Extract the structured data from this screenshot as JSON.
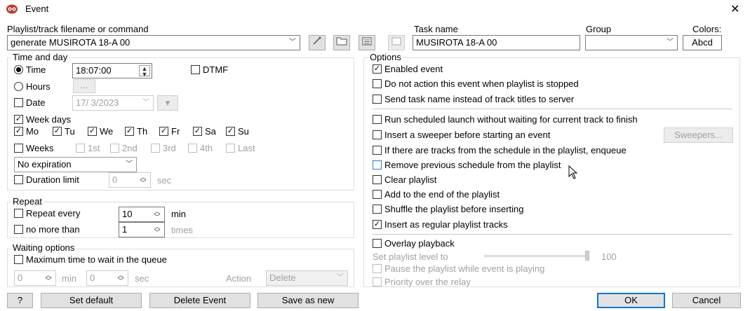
{
  "window": {
    "title": "Event",
    "close": "✕"
  },
  "top": {
    "playlist_label": "Playlist/track filename or command",
    "playlist_value": "generate MUSIROTA 18-A 00",
    "task_label": "Task name",
    "task_value": "MUSIROTA 18-A 00",
    "group_label": "Group",
    "group_value": "",
    "colors_label": "Colors:",
    "colors_value": "Abcd"
  },
  "time_day": {
    "title": "Time and day",
    "time_label": "Time",
    "time_value": "18:07:00",
    "dtmf_label": "DTMF",
    "hours_label": "Hours",
    "hours_btn": "...",
    "date_label": "Date",
    "date_value": "17/ 3/2023",
    "week_days_label": "Week days",
    "days": [
      "Mo",
      "Tu",
      "We",
      "Th",
      "Fr",
      "Sa",
      "Su"
    ],
    "weeks_label": "Weeks",
    "weeks": [
      "1st",
      "2nd",
      "3rd",
      "4th",
      "Last"
    ],
    "expiration_value": "No expiration",
    "duration_label": "Duration limit",
    "duration_value": "0",
    "duration_unit": "sec"
  },
  "repeat": {
    "title": "Repeat",
    "every_label": "Repeat every",
    "every_value": "10",
    "every_unit": "min",
    "nomore_label": "no more than",
    "nomore_value": "1",
    "nomore_unit": "times"
  },
  "waiting": {
    "title": "Waiting options",
    "max_label": "Maximum time to wait in the queue",
    "min_value": "0",
    "min_unit": "min",
    "sec_value": "0",
    "sec_unit": "sec",
    "action_label": "Action",
    "action_value": "Delete"
  },
  "options": {
    "title": "Options",
    "enabled": "Enabled event",
    "no_action": "Do not action this event when playlist is stopped",
    "send_task": "Send task name instead of track titles to server",
    "run_sched": "Run scheduled launch without waiting for current track to finish",
    "sweeper": "Insert a sweeper before starting an event",
    "sweepers_btn": "Sweepers...",
    "enqueue": "If there are tracks from the schedule in the playlist, enqueue",
    "remove_prev": "Remove previous schedule from the playlist",
    "clear": "Clear playlist",
    "add_end": "Add to the end of the playlist",
    "shuffle": "Shuffle the playlist before inserting",
    "regular": "Insert as regular playlist tracks",
    "overlay": "Overlay playback",
    "level_label": "Set playlist level to",
    "level_value": "100",
    "level_fraction": 1.0,
    "pause": "Pause the playlist while event is playing",
    "priority": "Priority over the relay"
  },
  "buttons": {
    "help": "?",
    "set_default": "Set default",
    "delete_event": "Delete Event",
    "save_new": "Save as new",
    "ok": "OK",
    "cancel": "Cancel"
  },
  "colors": {
    "accent": "#0078d7",
    "title_icon": "#c0392b"
  }
}
